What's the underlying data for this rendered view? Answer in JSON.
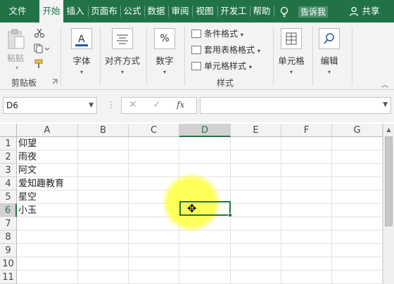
{
  "tabs": [
    "文件",
    "开始",
    "插入",
    "页面布",
    "公式",
    "数据",
    "审阅",
    "视图",
    "开发工",
    "帮助"
  ],
  "tell_me": "告诉我",
  "share": "共享",
  "ribbon": {
    "clipboard": {
      "paste": "粘贴",
      "group": "剪贴板"
    },
    "font": {
      "label": "字体"
    },
    "alignment": {
      "label": "对齐方式"
    },
    "number": {
      "label": "数字",
      "icon_text": "%"
    },
    "styles": {
      "conditional": "条件格式",
      "table": "套用表格格式",
      "cell_styles": "单元格样式",
      "group": "样式"
    },
    "cells": {
      "label": "单元格"
    },
    "editing": {
      "label": "编辑"
    }
  },
  "formula_bar": {
    "name_box": "D6",
    "fx": "fx",
    "formula": ""
  },
  "columns": [
    "A",
    "B",
    "C",
    "D",
    "E",
    "F",
    "G"
  ],
  "selected_column": "D",
  "rows": [
    {
      "num": "1",
      "a": "仰望"
    },
    {
      "num": "2",
      "a": "雨夜"
    },
    {
      "num": "3",
      "a": "阿文"
    },
    {
      "num": "4",
      "a": "爱知趣教育"
    },
    {
      "num": "5",
      "a": "星空"
    },
    {
      "num": "6",
      "a": "小玉"
    },
    {
      "num": "7",
      "a": ""
    },
    {
      "num": "8",
      "a": ""
    },
    {
      "num": "9",
      "a": ""
    },
    {
      "num": "10",
      "a": ""
    },
    {
      "num": "11",
      "a": ""
    }
  ],
  "selected_row": "6",
  "colors": {
    "accent": "#217346",
    "highlight": "#ffff50"
  }
}
